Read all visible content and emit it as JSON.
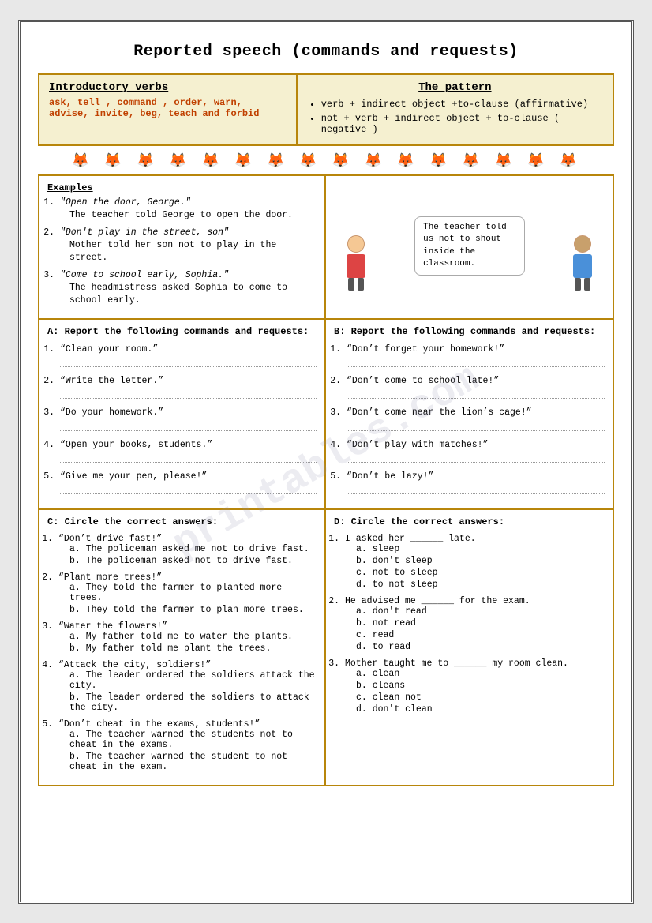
{
  "page": {
    "title": "Reported speech (commands and requests)",
    "watermark": "printables.com"
  },
  "intro": {
    "verbs_title": "Introductory verbs",
    "verbs_list": "ask, tell , command , order, warn, advise, invite, beg, teach and forbid",
    "pattern_title": "The pattern",
    "pattern_affirmative": "verb + indirect object +to-clause (affirmative)",
    "pattern_negative": "not + verb + indirect object + to-clause ( negative )"
  },
  "foxes": "🦊 🦊 🦊 🦊 🦊 🦊 🦊 🦊 🦊 🦊 🦊 🦊 🦊 🦊 🦊",
  "examples": {
    "title": "Examples",
    "items": [
      {
        "quote": "\"Open the door, George.\"",
        "reported": "The teacher told George to open the door."
      },
      {
        "quote": "\"Don't play in the street, son\"",
        "reported": "Mother told her son not to play in the street."
      },
      {
        "quote": "\"Come to school early, Sophia.\"",
        "reported": "The headmistress asked Sophia to come to school early."
      }
    ]
  },
  "image_caption": "The teacher told us not to shout inside the classroom.",
  "sectionA": {
    "title": "A: Report the following commands and requests:",
    "items": [
      "“Clean your room.”",
      "“Write the letter.”",
      "“Do your homework.”",
      "“Open your books, students.”",
      "“Give me your pen, please!”"
    ]
  },
  "sectionB": {
    "title": "B: Report the following commands and requests:",
    "items": [
      "“Don’t forget your homework!”",
      "“Don’t come to school late!”",
      "“Don’t come near the lion’s cage!”",
      "“Don’t play with matches!”",
      "“Don’t be lazy!”"
    ]
  },
  "sectionC": {
    "title": "C: Circle the correct answers:",
    "items": [
      {
        "quote": "“Don’t drive fast!”",
        "options": [
          {
            "label": "a.",
            "text": "The policeman asked me not to drive fast."
          },
          {
            "label": "b.",
            "text": "The policeman asked not to drive fast."
          }
        ]
      },
      {
        "quote": "“Plant more trees!”",
        "options": [
          {
            "label": "a.",
            "text": "They told the farmer to planted more trees."
          },
          {
            "label": "b.",
            "text": "They told the farmer to plan more trees."
          }
        ]
      },
      {
        "quote": "“Water the flowers!”",
        "options": [
          {
            "label": "a.",
            "text": "My father told me to water the plants."
          },
          {
            "label": "b.",
            "text": "My father told me plant the trees."
          }
        ]
      },
      {
        "quote": "“Attack the city, soldiers!”",
        "options": [
          {
            "label": "a.",
            "text": "The leader ordered the soldiers attack the city."
          },
          {
            "label": "b.",
            "text": "The leader ordered the soldiers to attack the city."
          }
        ]
      },
      {
        "quote": "“Don’t cheat in the exams, students!”",
        "options": [
          {
            "label": "a.",
            "text": "The teacher warned the students not to cheat in the exams."
          },
          {
            "label": "b.",
            "text": "The teacher warned the student to not cheat in the exam."
          }
        ]
      }
    ]
  },
  "sectionD": {
    "title": "D: Circle the correct answers:",
    "items": [
      {
        "stem": "I asked her ______ late.",
        "options": [
          {
            "label": "a.",
            "text": "sleep"
          },
          {
            "label": "b.",
            "text": "don't sleep"
          },
          {
            "label": "c.",
            "text": "not to sleep"
          },
          {
            "label": "d.",
            "text": "to not sleep"
          }
        ]
      },
      {
        "stem": "He advised me ______ for the exam.",
        "options": [
          {
            "label": "a.",
            "text": "don't read"
          },
          {
            "label": "b.",
            "text": "not read"
          },
          {
            "label": "c.",
            "text": "read"
          },
          {
            "label": "d.",
            "text": "to read"
          }
        ]
      },
      {
        "stem": "Mother taught me to ______ my room clean.",
        "options": [
          {
            "label": "a.",
            "text": "clean"
          },
          {
            "label": "b.",
            "text": "cleans"
          },
          {
            "label": "c.",
            "text": "clean not"
          },
          {
            "label": "d.",
            "text": "don't clean"
          }
        ]
      }
    ]
  }
}
